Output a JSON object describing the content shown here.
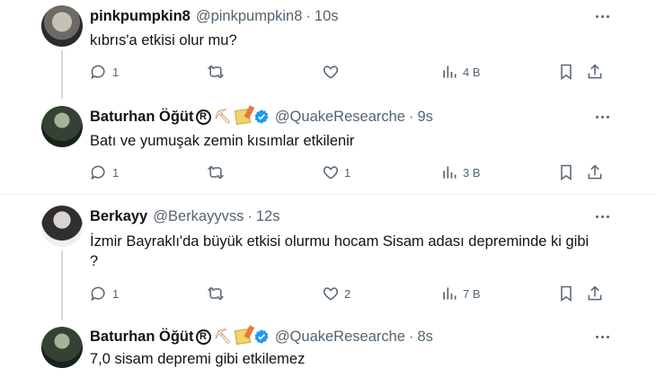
{
  "tweets": [
    {
      "name": "pinkpumpkin8",
      "handle": "@pinkpumpkin8",
      "time": "10s",
      "text": "kıbrıs'a etkisi olur mu?",
      "replies": "1",
      "retweets": "",
      "likes": "",
      "views": "4 B"
    },
    {
      "name": "Baturhan Öğüt",
      "handle": "@QuakeResearche",
      "time": "9s",
      "text": "Batı ve yumuşak zemin kısımlar etkilenir",
      "replies": "1",
      "retweets": "",
      "likes": "1",
      "views": "3 B"
    },
    {
      "name": "Berkayy",
      "handle": "@Berkayyvss",
      "time": "12s",
      "text_line1": "İzmir Bayraklı'da büyük etkisi olurmu hocam Sisam adası depreminde ki gibi",
      "text_line2": "?",
      "replies": "1",
      "retweets": "",
      "likes": "2",
      "views": "7 B"
    },
    {
      "name": "Baturhan Öğüt",
      "handle": "@QuakeResearche",
      "time": "8s",
      "text": "7,0 sisam depremi gibi etkilemez"
    }
  ],
  "sep": "·",
  "registered_symbol": "R",
  "pick_symbol": "⛏",
  "colors": {
    "text": "#0f1419",
    "secondary": "#536471",
    "verified": "#1d9bf0",
    "thread_line": "#cfd9de",
    "divider": "#eff3f4"
  },
  "icons": [
    "reply-icon",
    "retweet-icon",
    "like-icon",
    "views-icon",
    "bookmark-icon",
    "share-icon",
    "more-icon",
    "verified-icon"
  ]
}
